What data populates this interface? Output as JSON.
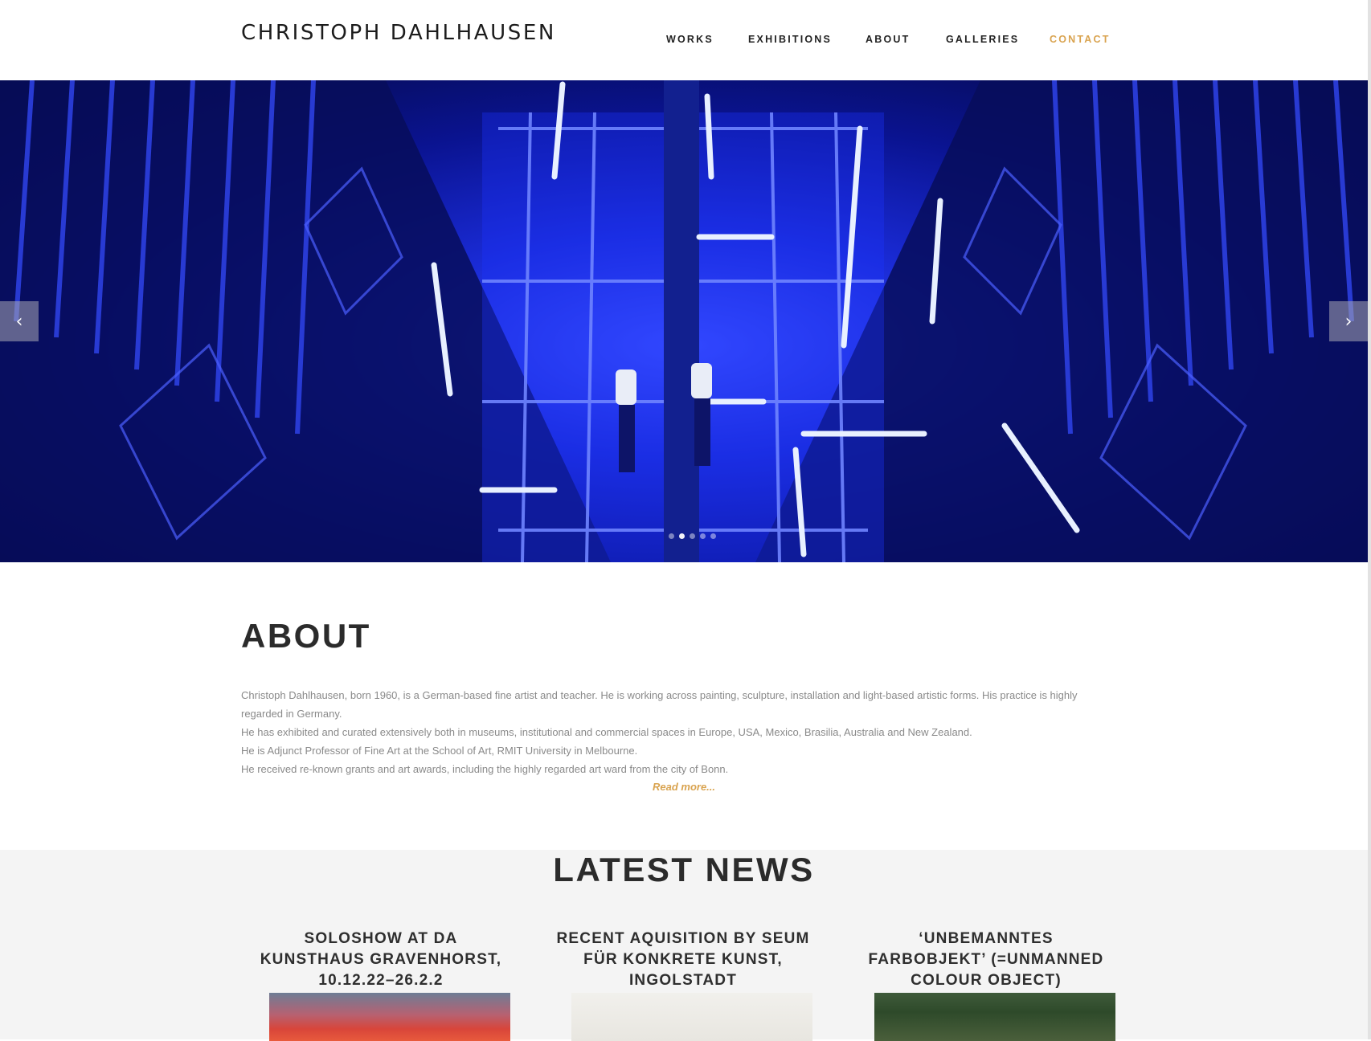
{
  "header": {
    "logo": "CHRISTOPH DAHLHAUSEN",
    "nav": [
      {
        "label": "WORKS"
      },
      {
        "label": "EXHIBITIONS"
      },
      {
        "label": "ABOUT"
      },
      {
        "label": "GALLERIES"
      },
      {
        "label": "CONTACT",
        "active": true
      }
    ]
  },
  "slider": {
    "prev_label": "‹",
    "next_label": "›",
    "slide_count": 5,
    "active_slide": 2
  },
  "about": {
    "title": "ABOUT",
    "paragraphs": [
      "Christoph Dahlhausen, born 1960, is a German-based fine artist and teacher. He is working across painting, sculpture, installation and light-based artistic forms. His practice is highly regarded in Germany.",
      "He has exhibited and curated extensively both in museums, institutional and commercial spaces in Europe, USA, Mexico, Brasilia, Australia and New Zealand.",
      "He is Adjunct Professor of Fine Art at the School of Art, RMIT University in Melbourne.",
      "He received re-known grants and art awards, including the highly regarded art ward from the city of Bonn."
    ],
    "read_more": "Read more..."
  },
  "news": {
    "title": "LATEST NEWS",
    "items": [
      {
        "title": "SOLOSHOW AT DA KUNSTHAUS GRAVENHORST, 10.12.22–26.2.2"
      },
      {
        "title": "RECENT AQUISITION BY SEUM FÜR KONKRETE KUNST, INGOLSTADT"
      },
      {
        "title": "‘UNBEMANNTES FARBOBJEKT’ (=UNMANNED COLOUR OBJECT)"
      }
    ]
  },
  "colors": {
    "accent": "#d9a34f",
    "text_dark": "#2b2b2b",
    "text_muted": "#8a8a8a",
    "news_bg": "#f4f4f4"
  }
}
